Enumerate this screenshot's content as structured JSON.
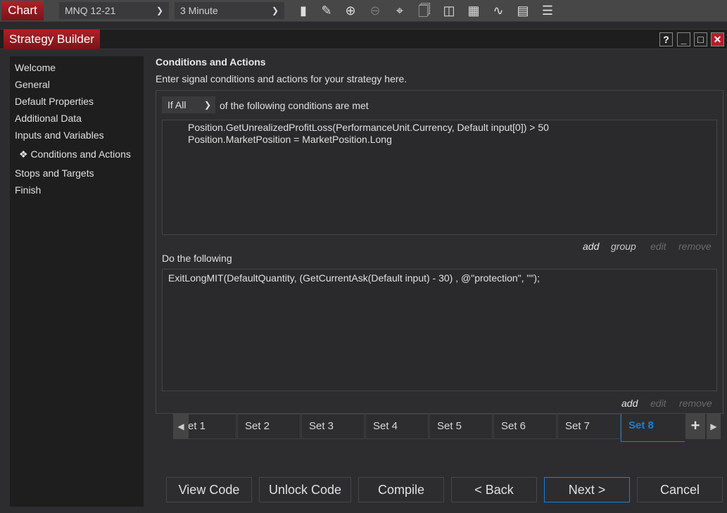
{
  "toolbar": {
    "chart_label": "Chart",
    "instrument": "MNQ 12-21",
    "interval": "3 Minute",
    "icons": [
      "bar-type-icon",
      "drawing-tool-icon",
      "zoom-in-icon",
      "zoom-out-icon",
      "crosshair-icon",
      "data-box-icon",
      "chart-trader-icon",
      "indicators-icon",
      "strategies-icon",
      "properties-icon",
      "templates-icon"
    ]
  },
  "window": {
    "title": "Strategy Builder",
    "help": "?",
    "minimize": "_",
    "maximize": "□",
    "close": "✕"
  },
  "sidebar": {
    "items": [
      {
        "label": "Welcome"
      },
      {
        "label": "General"
      },
      {
        "label": "Default Properties"
      },
      {
        "label": "Additional Data"
      },
      {
        "label": "Inputs and Variables"
      },
      {
        "label": "❖ Conditions and Actions",
        "active": true
      },
      {
        "label": "Stops and Targets"
      },
      {
        "label": "Finish"
      }
    ]
  },
  "main": {
    "heading": "Conditions and Actions",
    "subtitle": "Enter signal conditions and actions for your strategy here.",
    "conditions": {
      "mode": "If All",
      "mode_suffix": "of the following conditions are met",
      "items": [
        "Position.GetUnrealizedProfitLoss(PerformanceUnit.Currency, Default input[0]) > 50",
        "Position.MarketPosition = MarketPosition.Long"
      ],
      "links": {
        "add": "add",
        "group": "group",
        "edit": "edit",
        "remove": "remove"
      }
    },
    "actions": {
      "label": "Do the following",
      "items": [
        "ExitLongMIT(DefaultQuantity, (GetCurrentAsk(Default input) - 30) , @\"protection\", \"\");"
      ],
      "links": {
        "add": "add",
        "edit": "edit",
        "remove": "remove"
      }
    },
    "sets": [
      "et 1",
      "Set 2",
      "Set 3",
      "Set 4",
      "Set 5",
      "Set 6",
      "Set 7",
      "Set 8"
    ],
    "active_set": "Set 8",
    "add_set": "+"
  },
  "buttons": {
    "view_code": "View Code",
    "unlock_code": "Unlock Code",
    "compile": "Compile",
    "back": "< Back",
    "next": "Next >",
    "cancel": "Cancel"
  },
  "colors": {
    "accent": "#1a7fd4",
    "brand_red": "#a01c24"
  }
}
